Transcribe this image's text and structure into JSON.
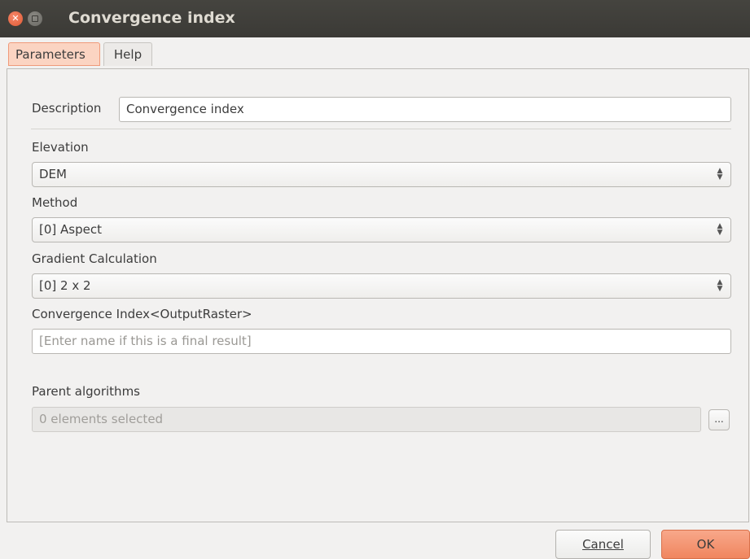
{
  "window": {
    "title": "Convergence index"
  },
  "tabs": [
    {
      "label": "Parameters",
      "active": true
    },
    {
      "label": "Help",
      "active": false
    }
  ],
  "form": {
    "description_label": "Description",
    "description_value": "Convergence index",
    "elevation_label": "Elevation",
    "elevation_value": "DEM",
    "method_label": "Method",
    "method_value": "[0] Aspect",
    "gradient_label": "Gradient Calculation",
    "gradient_value": "[0] 2 x 2",
    "output_label": "Convergence Index<OutputRaster>",
    "output_placeholder": "[Enter name if this is a final result]",
    "parent_label": "Parent algorithms",
    "parent_value": "0 elements selected",
    "parent_button": "..."
  },
  "buttons": {
    "cancel": "Cancel",
    "ok": "OK"
  },
  "colors": {
    "titlebar": "#3b3a36",
    "accent": "#f0865f",
    "active_tab": "#fbd4c2",
    "window_bg": "#f2f1f0"
  },
  "icons": {
    "close": "close-icon",
    "maximize": "maximize-icon",
    "combo": "up-down-arrows-icon"
  }
}
